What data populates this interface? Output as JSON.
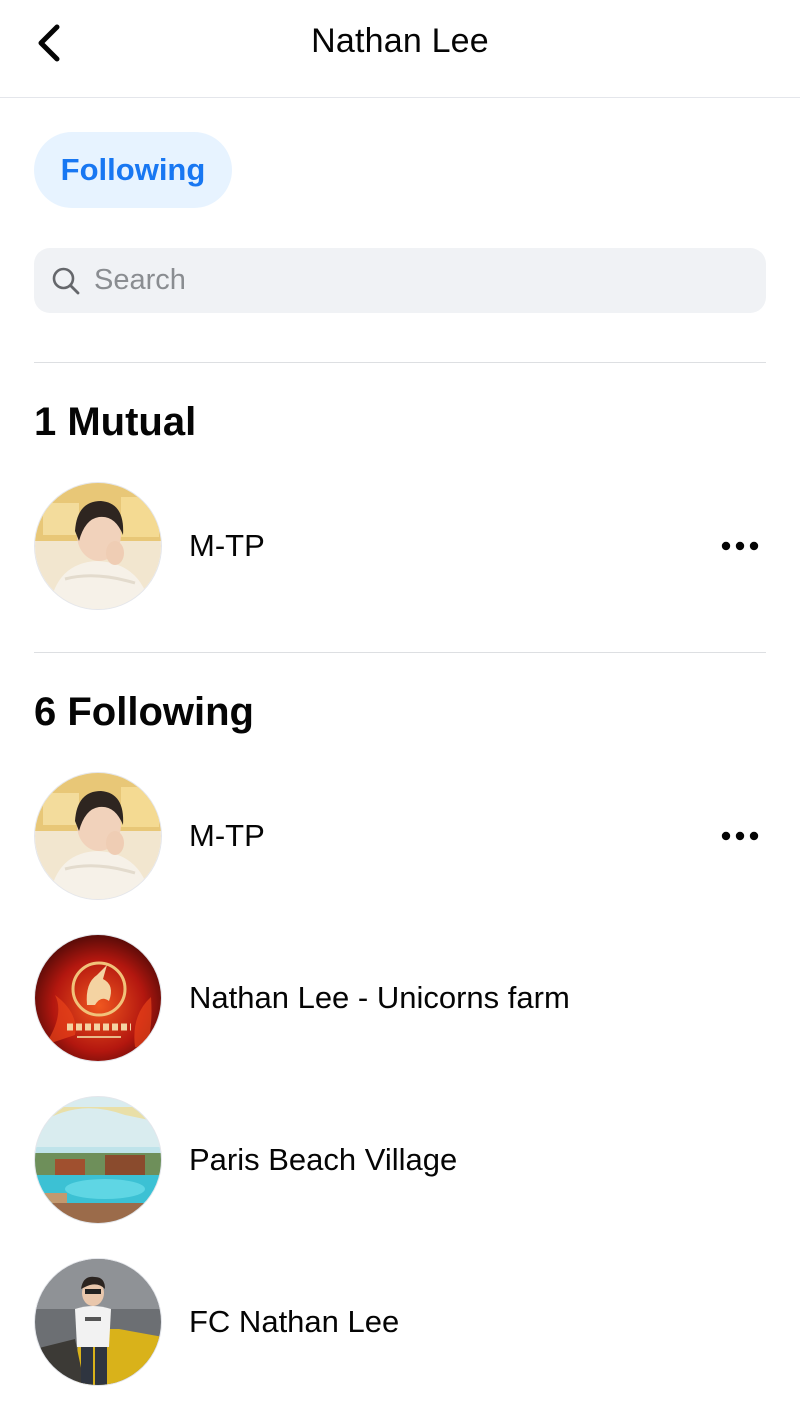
{
  "header": {
    "title": "Nathan Lee",
    "back_icon": "chevron-left-icon"
  },
  "filter_chip": {
    "label": "Following",
    "accent": "#1877f2",
    "background": "#e7f3ff"
  },
  "search": {
    "placeholder": "Search",
    "value": "",
    "icon": "search-icon"
  },
  "mutual_section": {
    "title": "1 Mutual",
    "items": [
      {
        "name": "M-TP",
        "has_more": true,
        "avatar": "mtp-avatar"
      }
    ]
  },
  "following_section": {
    "title": "6 Following",
    "items": [
      {
        "name": "M-TP",
        "has_more": true,
        "avatar": "mtp-avatar"
      },
      {
        "name": "Nathan Lee - Unicorns farm",
        "has_more": false,
        "avatar": "unicorns-logo-avatar"
      },
      {
        "name": "Paris Beach Village",
        "has_more": false,
        "avatar": "beach-resort-avatar"
      },
      {
        "name": "FC Nathan Lee",
        "has_more": false,
        "avatar": "fc-car-avatar"
      }
    ]
  },
  "more_icon": "more-horizontal-icon"
}
